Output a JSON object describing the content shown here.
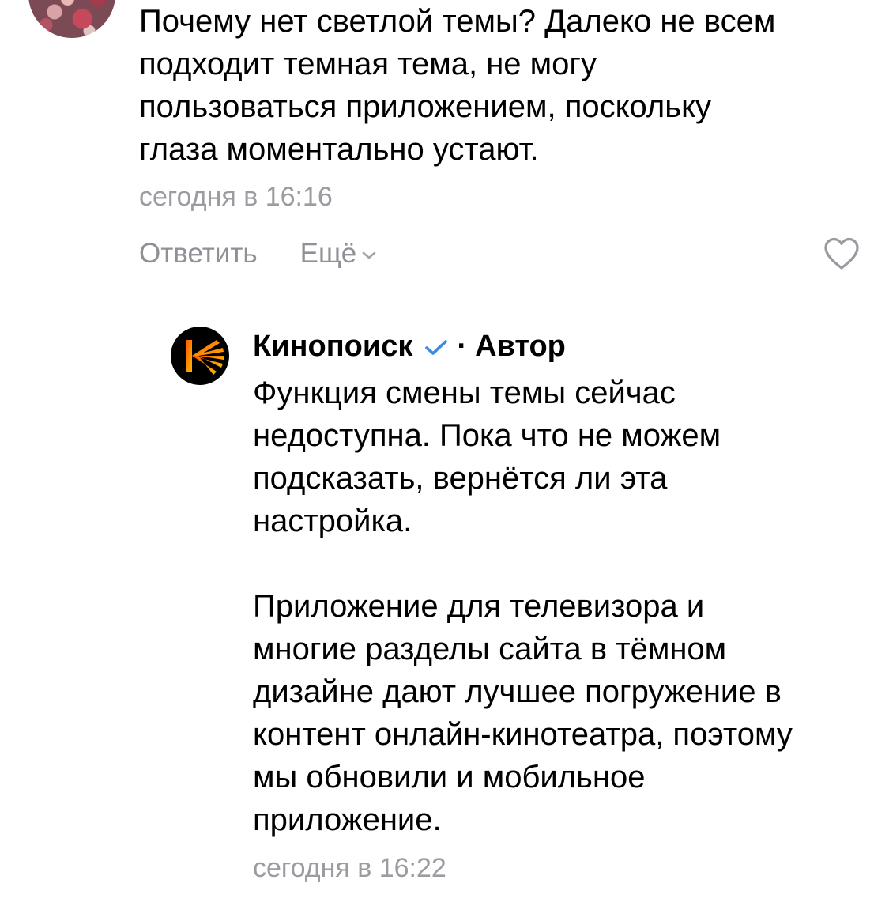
{
  "comment": {
    "avatar": "user-avatar",
    "text": "Почему нет светлой темы? Далеко не всем\nподходит темная тема, не могу\nпользоваться приложением, поскольку\nглаза моментально устают.",
    "timestamp": "сегодня в 16:16",
    "actions": {
      "reply_label": "Ответить",
      "more_label": "Ещё",
      "more_icon": "chevron-down-icon",
      "like_icon": "heart-outline-icon"
    }
  },
  "reply": {
    "author": "Кинопоиск",
    "verified_icon": "verified-check-icon",
    "separator": "·",
    "role": "Автор",
    "text": "Функция смены темы сейчас\nнедоступна. Пока что не можем\nподсказать, вернётся ли эта\nнастройка.\n\nПриложение для телевизора и\nмногие разделы сайта в тёмном\nдизайне дают лучшее погружение в\nконтент онлайн-кинотеатра, поэтому\nмы обновили и мобильное\nприложение.",
    "timestamp": "сегодня в 16:22"
  },
  "colors": {
    "text": "#000000",
    "secondary": "#9b9ba0",
    "actions": "#909096",
    "verified": "#3f8ae0",
    "brand_orange": "#ff5500",
    "brand_yellow": "#ffb800"
  }
}
